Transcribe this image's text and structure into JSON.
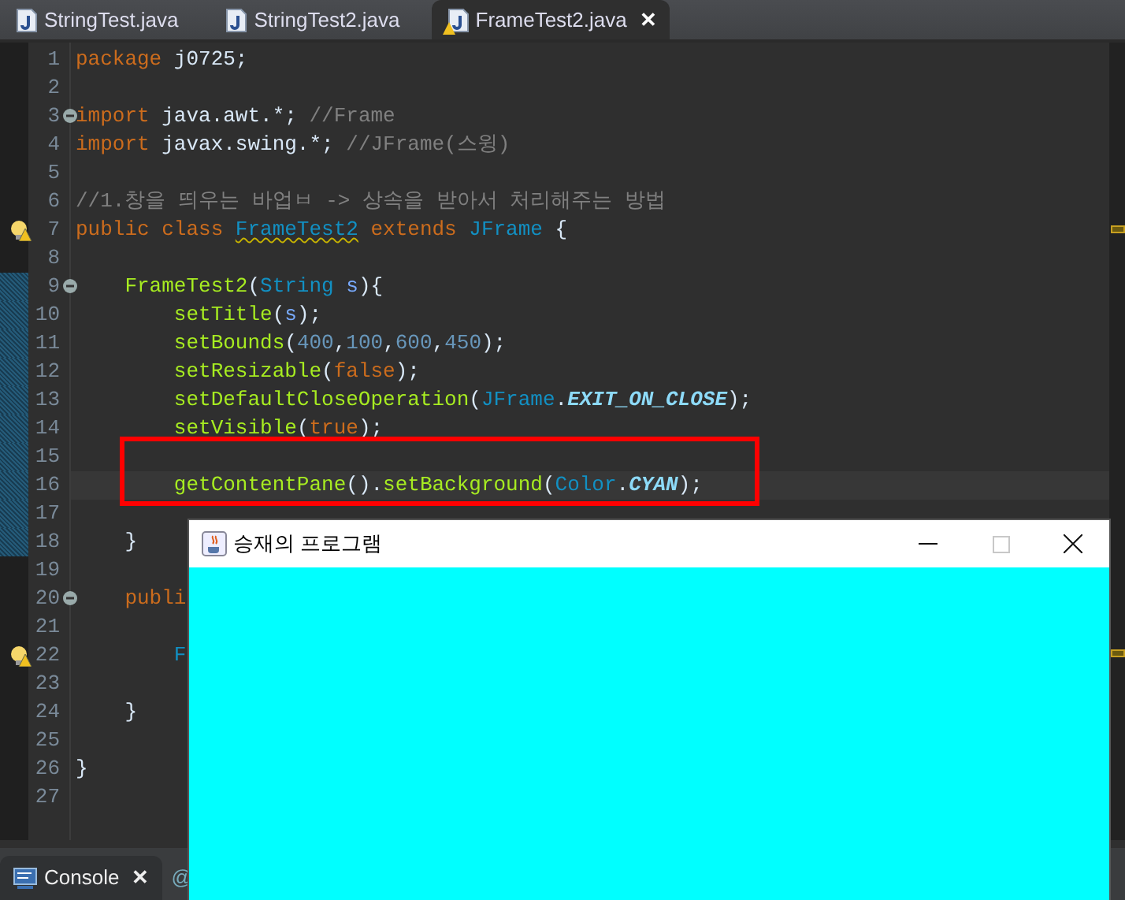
{
  "editor_tabs": [
    {
      "label": "StringTest.java",
      "selected": false,
      "warning": false
    },
    {
      "label": "StringTest2.java",
      "selected": false,
      "warning": false
    },
    {
      "label": "FrameTest2.java",
      "selected": true,
      "warning": true,
      "close": "✕"
    }
  ],
  "code_lines": [
    {
      "number": "1",
      "tokens": [
        {
          "kind": "keyword",
          "text": "package"
        },
        {
          "kind": "plain",
          "text": " j0725;"
        }
      ]
    },
    {
      "number": "2"
    },
    {
      "number": "3",
      "foldable": true,
      "tokens": [
        {
          "kind": "keyword",
          "text": "import"
        },
        {
          "kind": "plain",
          "text": " java.awt.*; "
        },
        {
          "kind": "comment",
          "text": "//Frame"
        }
      ]
    },
    {
      "number": "4",
      "tokens": [
        {
          "kind": "keyword",
          "text": "import"
        },
        {
          "kind": "plain",
          "text": " javax.swing.*; "
        },
        {
          "kind": "comment",
          "text": "//JFrame(스윙)"
        }
      ]
    },
    {
      "number": "5"
    },
    {
      "number": "6",
      "tokens": [
        {
          "kind": "comment",
          "text": "//1.창을 띄우는 바업ㅂ -> 상속을 받아서 처리해주는 방법"
        }
      ]
    },
    {
      "number": "7",
      "warning": true,
      "tokens": [
        {
          "kind": "keyword",
          "text": "public class "
        },
        {
          "kind": "type",
          "text": "FrameTest2",
          "warning": true
        },
        {
          "kind": "keyword",
          "text": " extends "
        },
        {
          "kind": "type",
          "text": "JFrame"
        },
        {
          "kind": "plain",
          "text": " {"
        }
      ]
    },
    {
      "number": "8"
    },
    {
      "number": "9",
      "foldable": true,
      "changed": true,
      "tokens": [
        {
          "kind": "method",
          "text": "    FrameTest2"
        },
        {
          "kind": "plain",
          "text": "("
        },
        {
          "kind": "type",
          "text": "String"
        },
        {
          "kind": "variable",
          "text": " s"
        },
        {
          "kind": "plain",
          "text": "){"
        }
      ]
    },
    {
      "number": "10",
      "changed": true,
      "tokens": [
        {
          "kind": "method",
          "text": "        setTitle"
        },
        {
          "kind": "plain",
          "text": "("
        },
        {
          "kind": "variable",
          "text": "s"
        },
        {
          "kind": "plain",
          "text": ");"
        }
      ]
    },
    {
      "number": "11",
      "changed": true,
      "tokens": [
        {
          "kind": "method",
          "text": "        setBounds"
        },
        {
          "kind": "plain",
          "text": "("
        },
        {
          "kind": "number",
          "text": "400"
        },
        {
          "kind": "plain",
          "text": ","
        },
        {
          "kind": "number",
          "text": "100"
        },
        {
          "kind": "plain",
          "text": ","
        },
        {
          "kind": "number",
          "text": "600"
        },
        {
          "kind": "plain",
          "text": ","
        },
        {
          "kind": "number",
          "text": "450"
        },
        {
          "kind": "plain",
          "text": ");"
        }
      ]
    },
    {
      "number": "12",
      "changed": true,
      "tokens": [
        {
          "kind": "method",
          "text": "        setResizable"
        },
        {
          "kind": "plain",
          "text": "("
        },
        {
          "kind": "keyword",
          "text": "false"
        },
        {
          "kind": "plain",
          "text": ");"
        }
      ]
    },
    {
      "number": "13",
      "changed": true,
      "tokens": [
        {
          "kind": "method",
          "text": "        setDefaultCloseOperation"
        },
        {
          "kind": "plain",
          "text": "("
        },
        {
          "kind": "type",
          "text": "JFrame"
        },
        {
          "kind": "plain",
          "text": "."
        },
        {
          "kind": "constant",
          "text": "EXIT_ON_CLOSE"
        },
        {
          "kind": "plain",
          "text": ");"
        }
      ]
    },
    {
      "number": "14",
      "changed": true,
      "tokens": [
        {
          "kind": "method",
          "text": "        setVisible"
        },
        {
          "kind": "plain",
          "text": "("
        },
        {
          "kind": "keyword",
          "text": "true"
        },
        {
          "kind": "plain",
          "text": ");"
        }
      ]
    },
    {
      "number": "15",
      "changed": true,
      "boxed": true
    },
    {
      "number": "16",
      "changed": true,
      "boxed": true,
      "current": true,
      "tokens": [
        {
          "kind": "method",
          "text": "        getContentPane"
        },
        {
          "kind": "plain",
          "text": "()."
        },
        {
          "kind": "method",
          "text": "setBackground"
        },
        {
          "kind": "plain",
          "text": "("
        },
        {
          "kind": "type",
          "text": "Color"
        },
        {
          "kind": "plain",
          "text": "."
        },
        {
          "kind": "constant",
          "text": "CYAN"
        },
        {
          "kind": "plain",
          "text": ");"
        }
      ]
    },
    {
      "number": "17",
      "changed": true
    },
    {
      "number": "18",
      "changed": true,
      "tokens": [
        {
          "kind": "plain",
          "text": "    }"
        }
      ]
    },
    {
      "number": "19"
    },
    {
      "number": "20",
      "foldable": true,
      "tokens": [
        {
          "kind": "keyword",
          "text": "    publi"
        }
      ]
    },
    {
      "number": "21"
    },
    {
      "number": "22",
      "warning": true,
      "tokens": [
        {
          "kind": "type",
          "text": "        F"
        }
      ]
    },
    {
      "number": "23"
    },
    {
      "number": "24",
      "tokens": [
        {
          "kind": "plain",
          "text": "    }"
        }
      ]
    },
    {
      "number": "25"
    },
    {
      "number": "26",
      "tokens": [
        {
          "kind": "plain",
          "text": "}"
        }
      ]
    },
    {
      "number": "27"
    }
  ],
  "bottom_tabs": [
    {
      "label": "Console",
      "selected": true,
      "close": "✕"
    },
    {
      "label": "@",
      "selected": false
    }
  ],
  "java_window": {
    "title": "승재의 프로그램",
    "resizable": false
  }
}
